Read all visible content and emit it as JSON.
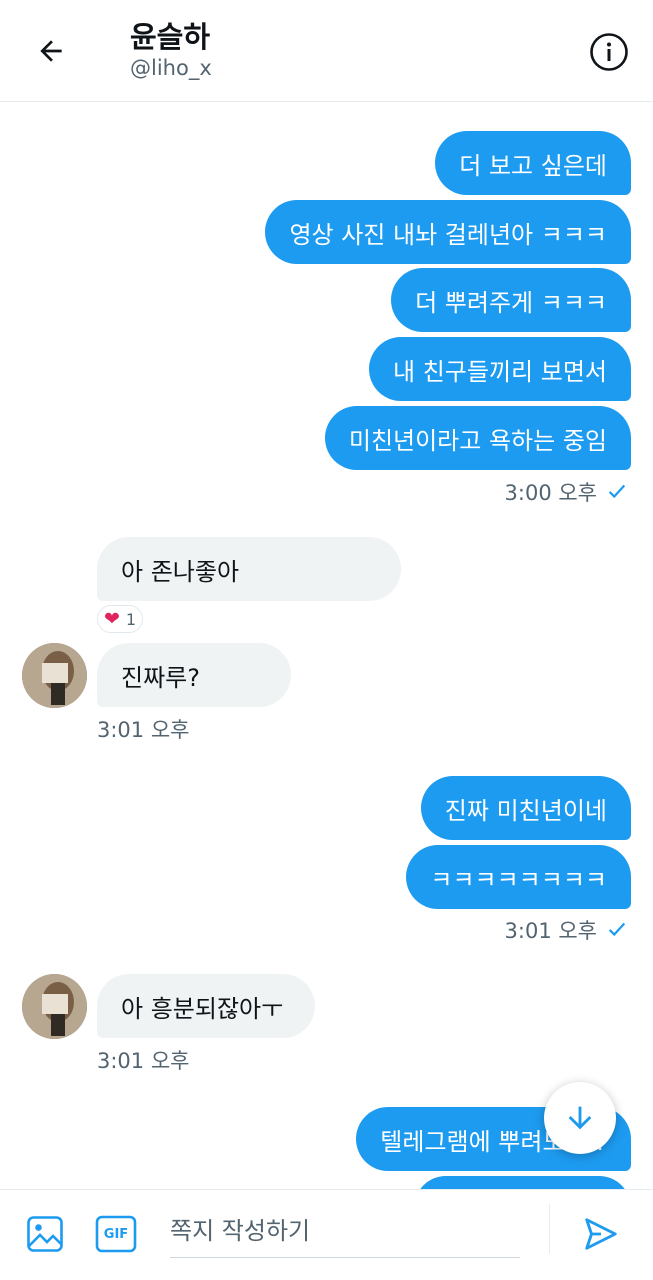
{
  "header": {
    "name": "윤슬하",
    "handle": "@liho_x",
    "back_icon": "arrow-left-icon",
    "info_icon": "info-circle-icon"
  },
  "messages": {
    "group1": [
      "더 보고 싶은데",
      "영상 사진 내놔 걸레년아 ㅋㅋㅋ",
      "더 뿌려주게 ㅋㅋㅋ",
      "내 친구들끼리 보면서",
      "미친년이라고 욕하는 중임"
    ],
    "group1_time": "3:00 오후",
    "recv1": "아 존나좋아",
    "reaction_emoji": "❤",
    "reaction_count": "1",
    "recv2": "진짜루?",
    "recv_time1": "3:01 오후",
    "group2": [
      "진짜 미친년이네",
      "ㅋㅋㅋㅋㅋㅋㅋㅋ"
    ],
    "group2_time": "3:01 오후",
    "recv3": "아 흥분되잖아ㅜ",
    "recv_time2": "3:01 오후",
    "group3": [
      "텔레그램에 뿌려도 됨?"
    ]
  },
  "composer": {
    "placeholder": "쪽지 작성하기",
    "gif_label": "GIF"
  },
  "colors": {
    "accent": "#1d9bf0",
    "received_bubble": "#eff3f4"
  }
}
